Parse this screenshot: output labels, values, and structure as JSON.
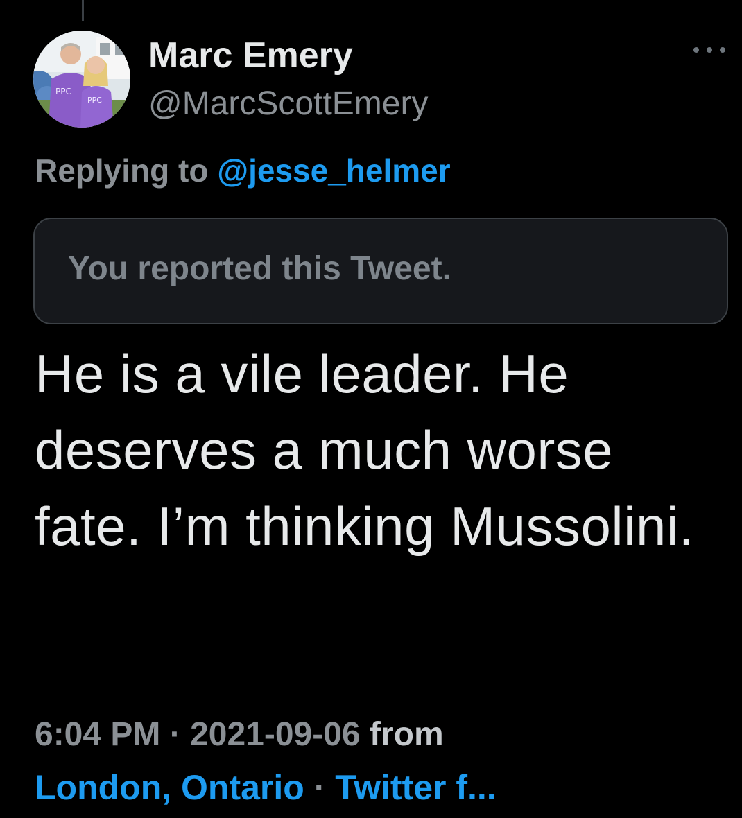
{
  "tweet": {
    "author": {
      "display_name": "Marc Emery",
      "handle": "@MarcScottEmery"
    },
    "avatar": {
      "shirt_text_left": "PPC",
      "shirt_text_right": "PPC"
    },
    "replying": {
      "label": "Replying to",
      "mention": "@jesse_helmer"
    },
    "notice": "You reported this Tweet.",
    "text": "He is a vile leader. He deserves a much worse fate. I’m thinking Mussolini.",
    "time": "6:04 PM",
    "separator": "·",
    "date": "2021-09-06",
    "from_label": "from",
    "location": "London, Ontario",
    "source": "Twitter f..."
  },
  "icons": {
    "more": "more-horizontal-icon"
  },
  "colors": {
    "background": "#000000",
    "link": "#1d9bf0",
    "primary_text": "#e7e9ea",
    "secondary_text": "#8b9095",
    "notice_bg": "#16181c",
    "avatar_shirt": "#8a5cc8"
  }
}
